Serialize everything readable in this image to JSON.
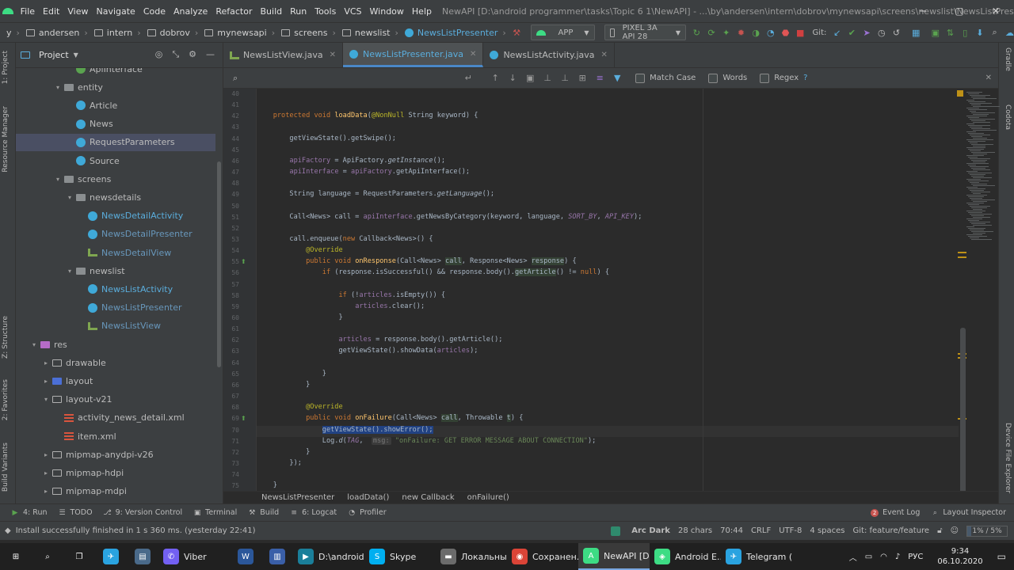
{
  "titlebar": {
    "menus": [
      "File",
      "Edit",
      "View",
      "Navigate",
      "Code",
      "Analyze",
      "Refactor",
      "Build",
      "Run",
      "Tools",
      "VCS",
      "Window",
      "Help"
    ],
    "title": "NewAPI [D:\\android programmer\\tasks\\Topic 6 1\\NewAPI] - ...\\by\\andersen\\intern\\dobrov\\mynewsapi\\screens\\newslist\\NewsListPresenter.java [app]",
    "controls": [
      "─",
      "▢",
      "✕"
    ]
  },
  "navbar": {
    "crumbs": [
      "y",
      "andersen",
      "intern",
      "dobrov",
      "mynewsapi",
      "screens",
      "newslist",
      "NewsListPresenter"
    ],
    "run_config": "APP",
    "device": "PIXEL 3A API 28",
    "git_label": "Git:"
  },
  "left_strip": {
    "labels": [
      "1: Project",
      "Resource Manager",
      "Z: Structure",
      "2: Favorites",
      "Build Variants"
    ]
  },
  "right_strip": {
    "labels": [
      "Gradle",
      "Codota",
      "Device File Explorer"
    ]
  },
  "project": {
    "title": "Project",
    "tree": [
      {
        "label": "ApiInterface",
        "depth": 4,
        "icon": "iface",
        "arrow": ""
      },
      {
        "label": "entity",
        "depth": 3,
        "icon": "pkg",
        "arrow": "▾"
      },
      {
        "label": "Article",
        "depth": 4,
        "icon": "class",
        "arrow": ""
      },
      {
        "label": "News",
        "depth": 4,
        "icon": "class",
        "arrow": ""
      },
      {
        "label": "RequestParameters",
        "depth": 4,
        "icon": "class",
        "arrow": "",
        "selected": true
      },
      {
        "label": "Source",
        "depth": 4,
        "icon": "class",
        "arrow": ""
      },
      {
        "label": "screens",
        "depth": 3,
        "icon": "pkg",
        "arrow": "▾"
      },
      {
        "label": "newsdetails",
        "depth": 4,
        "icon": "pkg",
        "arrow": "▾"
      },
      {
        "label": "NewsDetailActivity",
        "depth": 5,
        "icon": "class",
        "arrow": ""
      },
      {
        "label": "NewsDetailPresenter",
        "depth": 5,
        "icon": "class",
        "arrow": ""
      },
      {
        "label": "NewsDetailView",
        "depth": 5,
        "icon": "kt",
        "arrow": ""
      },
      {
        "label": "newslist",
        "depth": 4,
        "icon": "pkg",
        "arrow": "▾"
      },
      {
        "label": "NewsListActivity",
        "depth": 5,
        "icon": "class",
        "arrow": ""
      },
      {
        "label": "NewsListPresenter",
        "depth": 5,
        "icon": "class",
        "arrow": ""
      },
      {
        "label": "NewsListView",
        "depth": 5,
        "icon": "kt",
        "arrow": ""
      },
      {
        "label": "res",
        "depth": 1,
        "icon": "res",
        "arrow": "▾"
      },
      {
        "label": "drawable",
        "depth": 2,
        "icon": "folder",
        "arrow": "▸"
      },
      {
        "label": "layout",
        "depth": 2,
        "icon": "layout",
        "arrow": "▸"
      },
      {
        "label": "layout-v21",
        "depth": 2,
        "icon": "folder",
        "arrow": "▾"
      },
      {
        "label": "activity_news_detail.xml",
        "depth": 3,
        "icon": "xml",
        "arrow": ""
      },
      {
        "label": "item.xml",
        "depth": 3,
        "icon": "xml",
        "arrow": ""
      },
      {
        "label": "mipmap-anydpi-v26",
        "depth": 2,
        "icon": "folder",
        "arrow": "▸"
      },
      {
        "label": "mipmap-hdpi",
        "depth": 2,
        "icon": "folder",
        "arrow": "▸"
      },
      {
        "label": "mipmap-mdpi",
        "depth": 2,
        "icon": "folder",
        "arrow": "▸"
      }
    ]
  },
  "tabs": [
    {
      "label": "NewsListView.java",
      "active": false
    },
    {
      "label": "NewsListPresenter.java",
      "active": true
    },
    {
      "label": "NewsListActivity.java",
      "active": false
    }
  ],
  "search": {
    "match_case": "Match Case",
    "words": "Words",
    "regex": "Regex",
    "help": "?"
  },
  "code_lines": [
    {
      "n": "40",
      "html": ""
    },
    {
      "n": "41",
      "html": ""
    },
    {
      "n": "42",
      "html": "    <span class=\"kw\">protected void</span> <span class=\"fn\">loadData</span>(<span class=\"ann\">@NonNull</span> String keyword) {"
    },
    {
      "n": "43",
      "html": ""
    },
    {
      "n": "44",
      "html": "        getViewState().getSwipe();"
    },
    {
      "n": "45",
      "html": ""
    },
    {
      "n": "46",
      "html": "        <span class=\"fld\">apiFactory</span> = ApiFactory.<span class=\"it\">getInstance</span>();"
    },
    {
      "n": "47",
      "html": "        <span class=\"fld\">apiInterface</span> = <span class=\"fld\">apiFactory</span>.getApiInterface();"
    },
    {
      "n": "48",
      "html": ""
    },
    {
      "n": "49",
      "html": "        String language = RequestParameters.<span class=\"it\">getLanguage</span>();"
    },
    {
      "n": "50",
      "html": ""
    },
    {
      "n": "51",
      "html": "        Call&lt;News&gt; call = <span class=\"fld\">apiInterface</span>.getNewsByCategory(keyword, language, <span class=\"stat\">SORT_BY</span>, <span class=\"stat\">API_KEY</span>);"
    },
    {
      "n": "52",
      "html": ""
    },
    {
      "n": "53",
      "html": "        call.enqueue(<span class=\"kw\">new</span> Callback&lt;News&gt;() {"
    },
    {
      "n": "54",
      "html": "            <span class=\"ann\">@Override</span>"
    },
    {
      "n": "55",
      "html": "            <span class=\"kw\">public void</span> <span class=\"fn\">onResponse</span>(Call&lt;News&gt; <span class=\"hl\">call</span>, Response&lt;News&gt; <span class=\"hl\">response</span>) {"
    },
    {
      "n": "56",
      "html": "                <span class=\"kw\">if</span> (response.isSuccessful() &amp;&amp; response.body().<span class=\"hl\">getArticle</span>() != <span class=\"kw\">null</span>) {"
    },
    {
      "n": "57",
      "html": ""
    },
    {
      "n": "58",
      "html": "                    <span class=\"kw\">if</span> (!<span class=\"fld\">articles</span>.isEmpty()) {"
    },
    {
      "n": "59",
      "html": "                        <span class=\"fld\">articles</span>.clear();"
    },
    {
      "n": "60",
      "html": "                    }"
    },
    {
      "n": "61",
      "html": ""
    },
    {
      "n": "62",
      "html": "                    <span class=\"fld\">articles</span> = response.body().getArticle();"
    },
    {
      "n": "63",
      "html": "                    getViewState().showData(<span class=\"fld\">articles</span>);"
    },
    {
      "n": "64",
      "html": ""
    },
    {
      "n": "65",
      "html": "                }"
    },
    {
      "n": "66",
      "html": "            }"
    },
    {
      "n": "67",
      "html": ""
    },
    {
      "n": "68",
      "html": "            <span class=\"ann\">@Override</span>"
    },
    {
      "n": "69",
      "html": "            <span class=\"kw\">public void</span> <span class=\"fn\">onFailure</span>(Call&lt;News&gt; <span class=\"hl\">call</span>, Throwable <span class=\"hl\">t</span>) {"
    },
    {
      "n": "70",
      "html": "                <span class=\"sel\">getViewState().showError();</span>",
      "current": true
    },
    {
      "n": "71",
      "html": "                Log.<span class=\"it\">d</span>(<span class=\"stat\">TAG</span>,  <span class=\"hint\">msg:</span> <span class=\"str\">\"onFailure: GET ERROR MESSAGE ABOUT CONNECTION\"</span>);"
    },
    {
      "n": "72",
      "html": "            }"
    },
    {
      "n": "73",
      "html": "        });"
    },
    {
      "n": "74",
      "html": ""
    },
    {
      "n": "75",
      "html": "    }"
    }
  ],
  "editor_breadcrumb": [
    "NewsListPresenter",
    "loadData()",
    "new Callback",
    "onFailure()"
  ],
  "tool_windows_left": [
    {
      "label": "4: Run",
      "icon": "▶"
    },
    {
      "label": "TODO",
      "icon": "☰"
    },
    {
      "label": "9: Version Control",
      "icon": "⎇"
    },
    {
      "label": "Terminal",
      "icon": "▣"
    },
    {
      "label": "Build",
      "icon": "⚒"
    },
    {
      "label": "6: Logcat",
      "icon": "≡"
    },
    {
      "label": "Profiler",
      "icon": "◔"
    }
  ],
  "tool_windows_right": [
    {
      "label": "Event Log",
      "icon": "2"
    },
    {
      "label": "Layout Inspector",
      "icon": "⌕"
    }
  ],
  "status": {
    "message": "Install successfully finished in 1 s 360 ms. (yesterday 22:41)",
    "theme": "Arc Dark",
    "chars": "28 chars",
    "position": "70:44",
    "line_sep": "CRLF",
    "encoding": "UTF-8",
    "indent": "4 spaces",
    "branch": "Git: feature/feature",
    "memory": "1% / 5%"
  },
  "taskbar": {
    "items": [
      {
        "label": "",
        "color": "#202020",
        "glyph": "⊞"
      },
      {
        "label": "",
        "color": "#202020",
        "glyph": "⌕"
      },
      {
        "label": "",
        "color": "#202020",
        "glyph": "❐"
      },
      {
        "label": "",
        "color": "#2aa3e0",
        "glyph": "✈"
      },
      {
        "label": "",
        "color": "#4a6a8a",
        "glyph": "▤"
      },
      {
        "label": "Viber",
        "color": "#7360f2",
        "glyph": "✆"
      },
      {
        "label": "",
        "color": "#2b579a",
        "glyph": "W"
      },
      {
        "label": "",
        "color": "#3a5fa8",
        "glyph": "▥"
      },
      {
        "label": "D:\\android...",
        "color": "#1a7f9a",
        "glyph": "▶"
      },
      {
        "label": "Skype",
        "color": "#00aff0",
        "glyph": "S"
      },
      {
        "label": "Локальны...",
        "color": "#6b6b6b",
        "glyph": "▬"
      },
      {
        "label": "Сохранен...",
        "color": "#db4437",
        "glyph": "◉"
      },
      {
        "label": "NewAPI [D...",
        "color": "#3ddc84",
        "glyph": "A",
        "active": true
      },
      {
        "label": "Android E...",
        "color": "#3ddc84",
        "glyph": "◈"
      },
      {
        "label": "Telegram (...",
        "color": "#2aa3e0",
        "glyph": "✈"
      }
    ],
    "lang": "РУС",
    "time": "9:34",
    "date": "06.10.2020"
  },
  "colors": {
    "accent": "#4a88c7",
    "selection": "#214283",
    "android_green": "#3ddc84"
  }
}
